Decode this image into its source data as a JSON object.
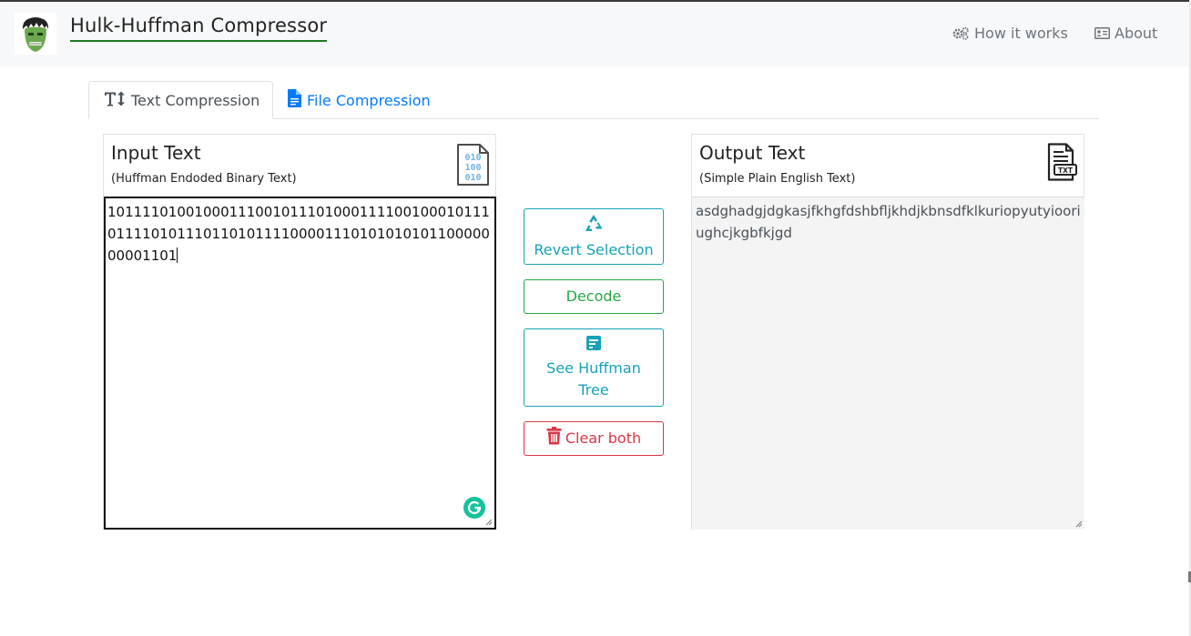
{
  "app": {
    "brand": "Hulk-Huffman Compressor",
    "nav": {
      "how_it_works": "How it works",
      "about": "About"
    }
  },
  "tabs": [
    {
      "label": "Text Compression",
      "icon": "text-height-icon",
      "active": true
    },
    {
      "label": "File Compression",
      "icon": "file-icon",
      "active": false
    }
  ],
  "input_panel": {
    "title": "Input Text",
    "subtitle": "(Huffman Endoded Binary Text)",
    "icon": "binary-file-icon",
    "value": "101111010010001110010111010001111001000101110111101011101101011110000111010101010110000000001101"
  },
  "output_panel": {
    "title": "Output Text",
    "subtitle": "(Simple Plain English Text)",
    "icon": "txt-file-icon",
    "value": "asdghadgjdgkasjfkhgfdshbfljkhdjkbnsdfklkuriopyutyiooriughcjkgbfkjgd"
  },
  "actions": {
    "revert": "Revert Selection",
    "decode": "Decode",
    "tree": "See Huffman Tree",
    "clear": "Clear both"
  },
  "colors": {
    "info": "#17a2b8",
    "success": "#28a745",
    "danger": "#dc3545",
    "primary": "#007bff",
    "brand_underline": "#1f7a1f"
  }
}
